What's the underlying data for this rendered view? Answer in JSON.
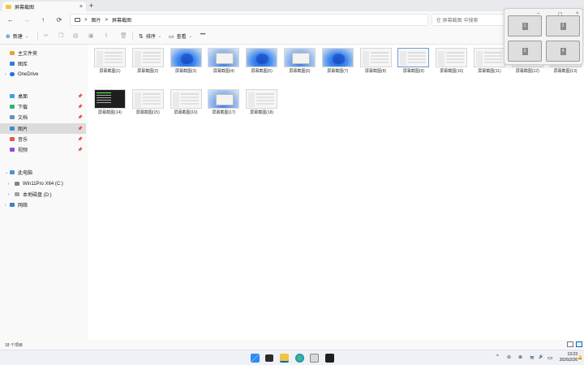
{
  "tab": {
    "title": "屏幕截图",
    "close": "×",
    "new": "+"
  },
  "address": {
    "back": "←",
    "forward": "→",
    "up": "↑",
    "refresh": "⟳",
    "sep1": ">",
    "crumb1": "图片",
    "sep2": ">",
    "crumb2": "屏幕截图",
    "search_placeholder": "在 屏幕截图 中搜索"
  },
  "commands": {
    "new": "新建",
    "sort": "排序",
    "view": "查看",
    "more": "•••"
  },
  "sidebar": {
    "home": "主文件夹",
    "gallery": "图库",
    "onedrive": "OneDrive",
    "desktop": "桌面",
    "downloads": "下载",
    "documents": "文档",
    "pictures": "图片",
    "music": "音乐",
    "videos": "视频",
    "thispc": "此电脑",
    "drive_c": "Win11Pro X64 (C:)",
    "drive_d": "本地磁盘 (D:)",
    "network": "网络"
  },
  "files": [
    {
      "name": "屏幕截图(1)",
      "kind": "shot"
    },
    {
      "name": "屏幕截图(2)",
      "kind": "shot"
    },
    {
      "name": "屏幕截图(3)",
      "kind": "win"
    },
    {
      "name": "屏幕截图(4)",
      "kind": "dialog"
    },
    {
      "name": "屏幕截图(5)",
      "kind": "win"
    },
    {
      "name": "屏幕截图(6)",
      "kind": "dialog"
    },
    {
      "name": "屏幕截图(7)",
      "kind": "win"
    },
    {
      "name": "屏幕截图(8)",
      "kind": "shot"
    },
    {
      "name": "屏幕截图(9)",
      "kind": "shot"
    },
    {
      "name": "屏幕截图(10)",
      "kind": "shot"
    },
    {
      "name": "屏幕截图(11)",
      "kind": "shot"
    },
    {
      "name": "屏幕截图(12)",
      "kind": "shot"
    },
    {
      "name": "屏幕截图(13)",
      "kind": "shot"
    },
    {
      "name": "屏幕截图(14)",
      "kind": "dark"
    },
    {
      "name": "屏幕截图(15)",
      "kind": "shot"
    },
    {
      "name": "屏幕截图(16)",
      "kind": "shot"
    },
    {
      "name": "屏幕截图(17)",
      "kind": "dialog"
    },
    {
      "name": "屏幕截图(18)",
      "kind": "shot"
    }
  ],
  "status": {
    "count": "18 个项目"
  },
  "snap": {
    "minimize": "–",
    "maximize": "▢",
    "close": "×",
    "z1": "1",
    "z2": "2",
    "z3": "3",
    "z4": "4"
  },
  "clock": {
    "time": "13:23",
    "date": "2026/2/26"
  },
  "tray": {
    "chevron": "^",
    "wifi": "≋",
    "volume": "🔊",
    "battery": "▭",
    "bell": "🔔"
  },
  "colors": {
    "accent": "#0067c0",
    "folder": "#f4c33e",
    "selected": "#dcdcdc"
  }
}
